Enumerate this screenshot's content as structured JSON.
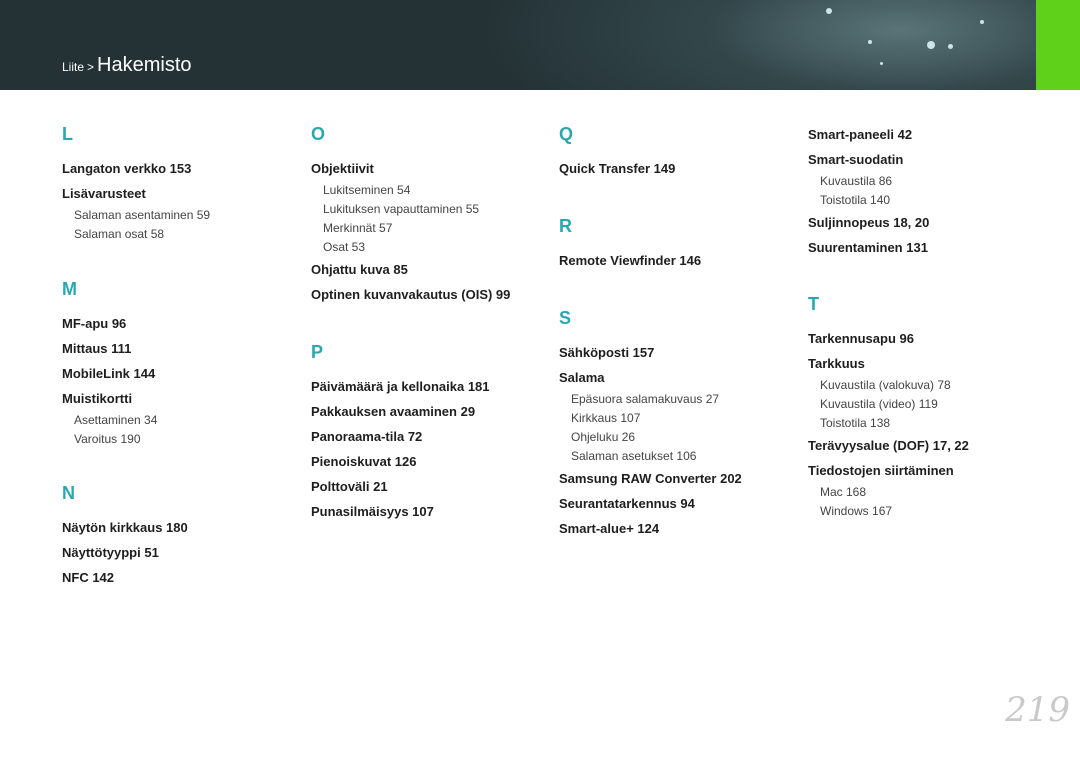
{
  "header": {
    "parent": "Liite",
    "separator": ">",
    "title": "Hakemisto"
  },
  "columns": [
    {
      "sections": [
        {
          "letter": "L",
          "entries": [
            {
              "label": "Langaton verkko  153",
              "subs": []
            },
            {
              "label": "Lisävarusteet",
              "subs": [
                "Salaman asentaminen  59",
                "Salaman osat  58"
              ]
            }
          ]
        },
        {
          "letter": "M",
          "entries": [
            {
              "label": "MF-apu  96",
              "subs": []
            },
            {
              "label": "Mittaus  111",
              "subs": []
            },
            {
              "label": "MobileLink  144",
              "subs": []
            },
            {
              "label": "Muistikortti",
              "subs": [
                "Asettaminen  34",
                "Varoitus  190"
              ]
            }
          ]
        },
        {
          "letter": "N",
          "entries": [
            {
              "label": "Näytön kirkkaus  180",
              "subs": []
            },
            {
              "label": "Näyttötyyppi  51",
              "subs": []
            },
            {
              "label": "NFC  142",
              "subs": []
            }
          ]
        }
      ]
    },
    {
      "sections": [
        {
          "letter": "O",
          "entries": [
            {
              "label": "Objektiivit",
              "subs": [
                "Lukitseminen  54",
                "Lukituksen vapauttaminen  55",
                "Merkinnät  57",
                "Osat  53"
              ]
            },
            {
              "label": "Ohjattu kuva  85",
              "subs": []
            },
            {
              "label": "Optinen kuvanvakautus (OIS)  99",
              "subs": []
            }
          ]
        },
        {
          "letter": "P",
          "entries": [
            {
              "label": "Päivämäärä ja kellonaika  181",
              "subs": []
            },
            {
              "label": "Pakkauksen avaaminen  29",
              "subs": []
            },
            {
              "label": "Panoraama-tila  72",
              "subs": []
            },
            {
              "label": "Pienoiskuvat  126",
              "subs": []
            },
            {
              "label": "Polttoväli  21",
              "subs": []
            },
            {
              "label": "Punasilmäisyys  107",
              "subs": []
            }
          ]
        }
      ]
    },
    {
      "sections": [
        {
          "letter": "Q",
          "entries": [
            {
              "label": "Quick Transfer  149",
              "subs": []
            }
          ]
        },
        {
          "letter": "R",
          "entries": [
            {
              "label": "Remote Viewfinder  146",
              "subs": []
            }
          ]
        },
        {
          "letter": "S",
          "entries": [
            {
              "label": "Sähköposti  157",
              "subs": []
            },
            {
              "label": "Salama",
              "subs": [
                "Epäsuora salamakuvaus  27",
                "Kirkkaus  107",
                "Ohjeluku  26",
                "Salaman asetukset  106"
              ]
            },
            {
              "label": "Samsung RAW Converter  202",
              "subs": []
            },
            {
              "label": "Seurantatarkennus  94",
              "subs": []
            },
            {
              "label": "Smart-alue+  124",
              "subs": []
            }
          ]
        }
      ]
    },
    {
      "sections": [
        {
          "letter": "",
          "entries": [
            {
              "label": "Smart-paneeli  42",
              "subs": []
            },
            {
              "label": "Smart-suodatin",
              "subs": [
                "Kuvaustila  86",
                "Toistotila  140"
              ]
            },
            {
              "label": "Suljinnopeus  18, 20",
              "subs": []
            },
            {
              "label": "Suurentaminen  131",
              "subs": []
            }
          ]
        },
        {
          "letter": "T",
          "entries": [
            {
              "label": "Tarkennusapu  96",
              "subs": []
            },
            {
              "label": "Tarkkuus",
              "subs": [
                "Kuvaustila (valokuva)  78",
                "Kuvaustila (video)  119",
                "Toistotila  138"
              ]
            },
            {
              "label": "Terävyysalue (DOF)  17, 22",
              "subs": []
            },
            {
              "label": "Tiedostojen siirtäminen",
              "subs": [
                "Mac  168",
                "Windows  167"
              ]
            }
          ]
        }
      ]
    }
  ],
  "page_number": "219",
  "colors": {
    "accent": "#2aa8b2",
    "tab": "#5fd11a",
    "header": "#2e3f42"
  }
}
